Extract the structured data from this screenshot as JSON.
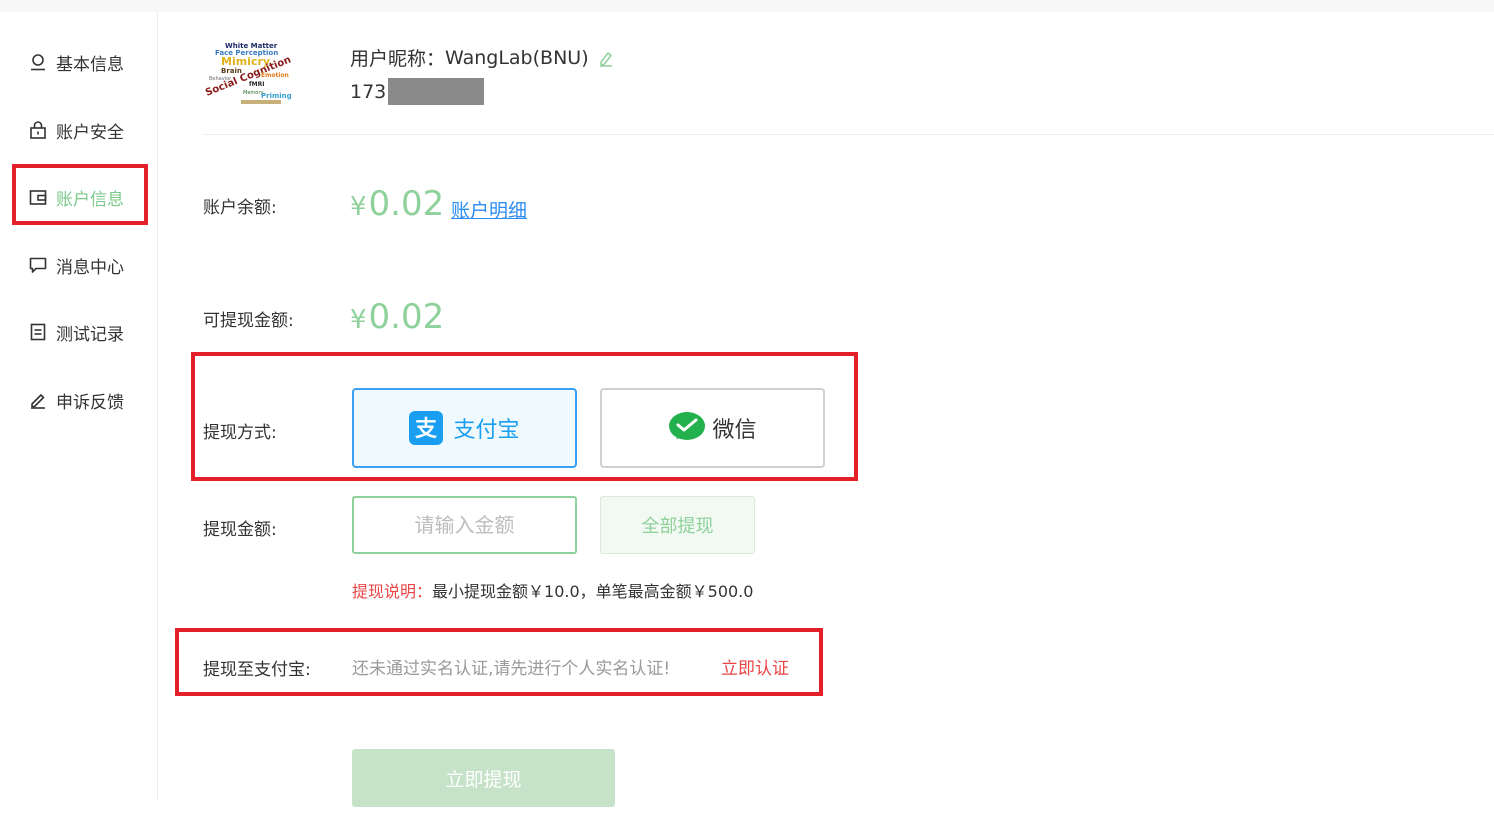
{
  "sidebar": {
    "items": [
      {
        "label": "基本信息",
        "icon": "user-icon"
      },
      {
        "label": "账户安全",
        "icon": "lock-icon"
      },
      {
        "label": "账户信息",
        "icon": "wallet-icon",
        "active": true
      },
      {
        "label": "消息中心",
        "icon": "message-icon"
      },
      {
        "label": "测试记录",
        "icon": "document-icon"
      },
      {
        "label": "申诉反馈",
        "icon": "pencil-icon"
      }
    ]
  },
  "profile": {
    "nickname_label": "用户昵称：",
    "nickname": "WangLab(BNU)",
    "phone_prefix": "173",
    "avatar_words": [
      "White Matter",
      "Face Perception",
      "Mimicry",
      "Brain",
      "Social Cognition",
      "fMRI",
      "Memory",
      "Priming",
      "Behavior",
      "Emotion"
    ]
  },
  "account": {
    "balance_label": "账户余额:",
    "balance_currency": "¥",
    "balance_value": "0.02",
    "detail_link": "账户明细",
    "withdrawable_label": "可提现金额:",
    "withdrawable_currency": "¥",
    "withdrawable_value": "0.02"
  },
  "withdraw": {
    "method_label": "提现方式:",
    "alipay_label": "支付宝",
    "wechat_label": "微信",
    "amount_label": "提现金额:",
    "amount_placeholder": "请输入金额",
    "all_button": "全部提现",
    "note_title": "提现说明：",
    "note_text": "最小提现金额￥10.0，单笔最高金额￥500.0",
    "to_alipay_label": "提现至支付宝:",
    "verify_message": "还未通过实名认证,请先进行个人实名认证!",
    "verify_link": "立即认证",
    "submit_button": "立即提现"
  },
  "colors": {
    "accent_green": "#8fd19b",
    "alipay_blue": "#1a9ef1",
    "highlight_red": "#e3202a",
    "link_blue": "#2d8cf0"
  }
}
